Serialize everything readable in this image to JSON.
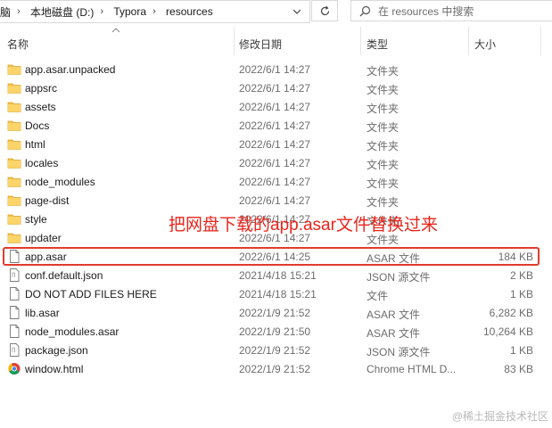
{
  "breadcrumb": {
    "items": [
      "脑",
      "本地磁盘 (D:)",
      "Typora",
      "resources"
    ]
  },
  "search": {
    "placeholder": "在 resources 中搜索"
  },
  "columns": {
    "name": "名称",
    "date": "修改日期",
    "type": "类型",
    "size": "大小"
  },
  "files": [
    {
      "name": "app.asar.unpacked",
      "date": "2022/6/1 14:27",
      "type": "文件夹",
      "size": "",
      "icon": "folder-icon"
    },
    {
      "name": "appsrc",
      "date": "2022/6/1 14:27",
      "type": "文件夹",
      "size": "",
      "icon": "folder-icon"
    },
    {
      "name": "assets",
      "date": "2022/6/1 14:27",
      "type": "文件夹",
      "size": "",
      "icon": "folder-icon"
    },
    {
      "name": "Docs",
      "date": "2022/6/1 14:27",
      "type": "文件夹",
      "size": "",
      "icon": "folder-icon"
    },
    {
      "name": "html",
      "date": "2022/6/1 14:27",
      "type": "文件夹",
      "size": "",
      "icon": "folder-icon"
    },
    {
      "name": "locales",
      "date": "2022/6/1 14:27",
      "type": "文件夹",
      "size": "",
      "icon": "folder-icon"
    },
    {
      "name": "node_modules",
      "date": "2022/6/1 14:27",
      "type": "文件夹",
      "size": "",
      "icon": "folder-icon"
    },
    {
      "name": "page-dist",
      "date": "2022/6/1 14:27",
      "type": "文件夹",
      "size": "",
      "icon": "folder-icon"
    },
    {
      "name": "style",
      "date": "2022/6/1 14:27",
      "type": "文件夹",
      "size": "",
      "icon": "folder-icon"
    },
    {
      "name": "updater",
      "date": "2022/6/1 14:27",
      "type": "文件夹",
      "size": "",
      "icon": "folder-icon"
    },
    {
      "name": "app.asar",
      "date": "2022/6/1 14:25",
      "type": "ASAR 文件",
      "size": "184 KB",
      "icon": "file-icon"
    },
    {
      "name": "conf.default.json",
      "date": "2021/4/18 15:21",
      "type": "JSON 源文件",
      "size": "2 KB",
      "icon": "json-file-icon"
    },
    {
      "name": "DO NOT ADD FILES HERE",
      "date": "2021/4/18 15:21",
      "type": "文件",
      "size": "1 KB",
      "icon": "file-icon"
    },
    {
      "name": "lib.asar",
      "date": "2022/1/9 21:52",
      "type": "ASAR 文件",
      "size": "6,282 KB",
      "icon": "file-icon"
    },
    {
      "name": "node_modules.asar",
      "date": "2022/1/9 21:50",
      "type": "ASAR 文件",
      "size": "10,264 KB",
      "icon": "file-icon"
    },
    {
      "name": "package.json",
      "date": "2022/1/9 21:52",
      "type": "JSON 源文件",
      "size": "1 KB",
      "icon": "json-file-icon"
    },
    {
      "name": "window.html",
      "date": "2022/1/9 21:52",
      "type": "Chrome HTML D...",
      "size": "83 KB",
      "icon": "chrome-icon"
    }
  ],
  "annotation": {
    "callout": "把网盘下载的app.asar文件替换过来"
  },
  "watermark": "@稀土掘金技术社区",
  "colors": {
    "folder": "#f5c24b",
    "highlight": "#e13b2e",
    "callout": "#e8251c"
  }
}
